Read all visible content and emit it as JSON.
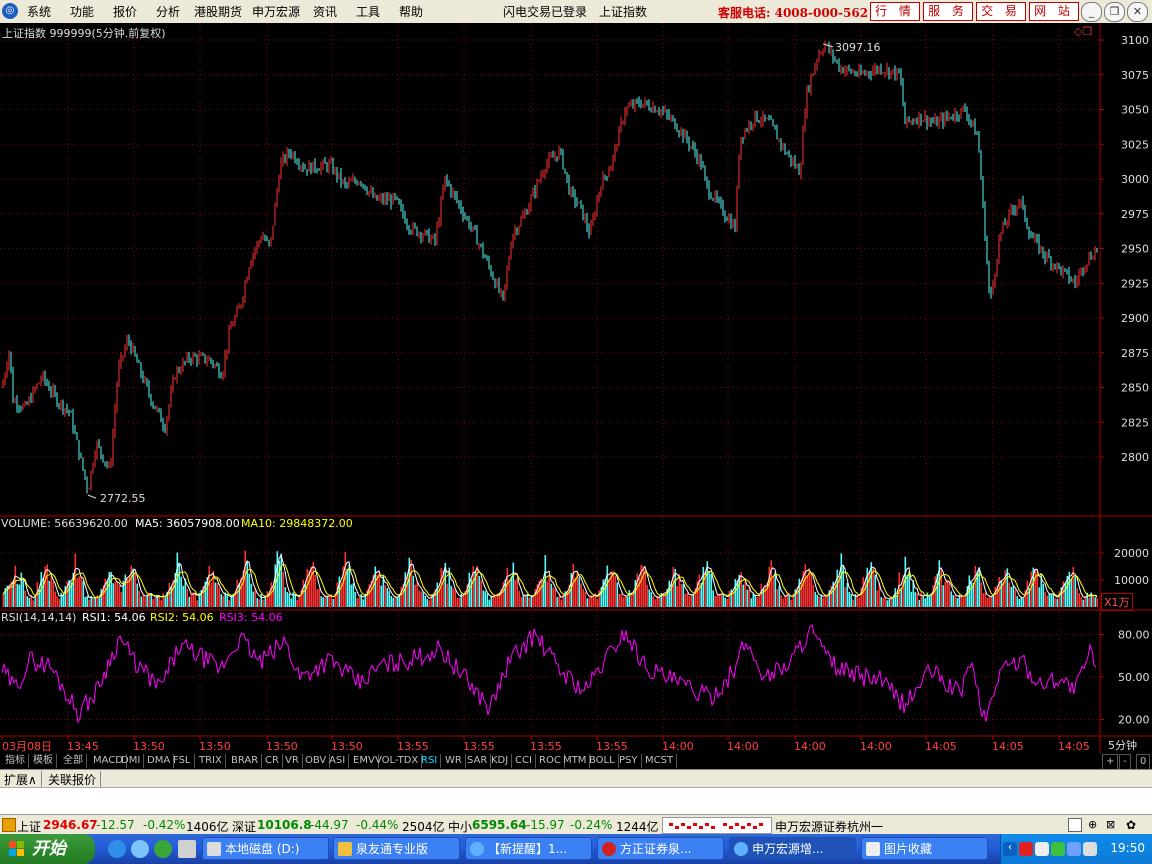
{
  "menu": {
    "items": [
      "系统",
      "功能",
      "报价",
      "分析",
      "港股期货",
      "申万宏源",
      "资讯",
      "工具",
      "帮助"
    ],
    "status": "闪电交易已登录",
    "index_name": "上证指数",
    "hotline": "客服电话: 4008-000-562",
    "buttons": [
      "行 情",
      "服 务",
      "交 易",
      "网 站"
    ]
  },
  "main_chart": {
    "header": "上证指数 999999(5分钟.前复权)",
    "y_ticks": [
      3100,
      3075,
      3050,
      3025,
      3000,
      2975,
      2950,
      2925,
      2900,
      2875,
      2850,
      2825,
      2800
    ],
    "high_label": "3097.16",
    "low_label": "2772.55"
  },
  "volume": {
    "header_volume": "VOLUME: 56639620.00",
    "header_ma5": "MA5: 36057908.00",
    "header_ma10": "MA10: 29848372.00",
    "y_ticks": [
      "20000",
      "10000"
    ],
    "unit": "X1万"
  },
  "rsi": {
    "header_name": "RSI(14,14,14)",
    "header_rsi1": "RSI1: 54.06",
    "header_rsi2": "RSI2: 54.06",
    "header_rsi3": "RSI3: 54.06",
    "y_ticks": [
      "80.00",
      "50.00",
      "20.00"
    ]
  },
  "time_axis": {
    "labels": [
      "03月08日",
      "13:45",
      "13:50",
      "13:50",
      "13:50",
      "13:50",
      "13:55",
      "13:55",
      "13:55",
      "13:55",
      "14:00",
      "14:00",
      "14:00",
      "14:00",
      "14:05",
      "14:05",
      "14:05"
    ],
    "period": "5分钟"
  },
  "indicator_tabs": [
    "指标",
    "模板",
    "全部",
    "MACD",
    "DMI",
    "DMA",
    "FSL",
    "TRIX",
    "BRAR",
    "CR",
    "VR",
    "OBV",
    "ASI",
    "EMV",
    "VOL-TDX",
    "RSI",
    "WR",
    "SAR",
    "KDJ",
    "CCI",
    "ROC",
    "MTM",
    "BOLL",
    "PSY",
    "MCST"
  ],
  "active_indicator": "RSI",
  "zoom_controls": [
    "+",
    "-",
    "0"
  ],
  "ext_tabs": [
    "扩展∧",
    "关联报价"
  ],
  "ticker": {
    "sh_label": "上证",
    "sh_price": "2946.67",
    "sh_chg": "-12.57",
    "sh_pct": "-0.42%",
    "sh_amt": "1406亿",
    "sz_label": "深证",
    "sz_price": "10106.8",
    "sz_chg": "-44.97",
    "sz_pct": "-0.44%",
    "sz_amt": "2504亿",
    "zx_label": "中小",
    "zx_price": "6595.64",
    "zx_chg": "-15.97",
    "zx_pct": "-0.24%",
    "zx_amt": "1244亿",
    "broker": "申万宏源证券杭州一"
  },
  "taskbar": {
    "start": "开始",
    "tasks": [
      "本地磁盘 (D:)",
      "泉友通专业版",
      "【新提醒】1...",
      "方正证券泉...",
      "申万宏源增...",
      "图片收藏"
    ],
    "clock": "19:50"
  },
  "colors": {
    "up": "#ff3232",
    "down": "#54fcfc",
    "rsi": "#ff00ff",
    "ma5": "#ffffff",
    "ma10": "#ffff00",
    "grid": "#8b0000"
  }
}
